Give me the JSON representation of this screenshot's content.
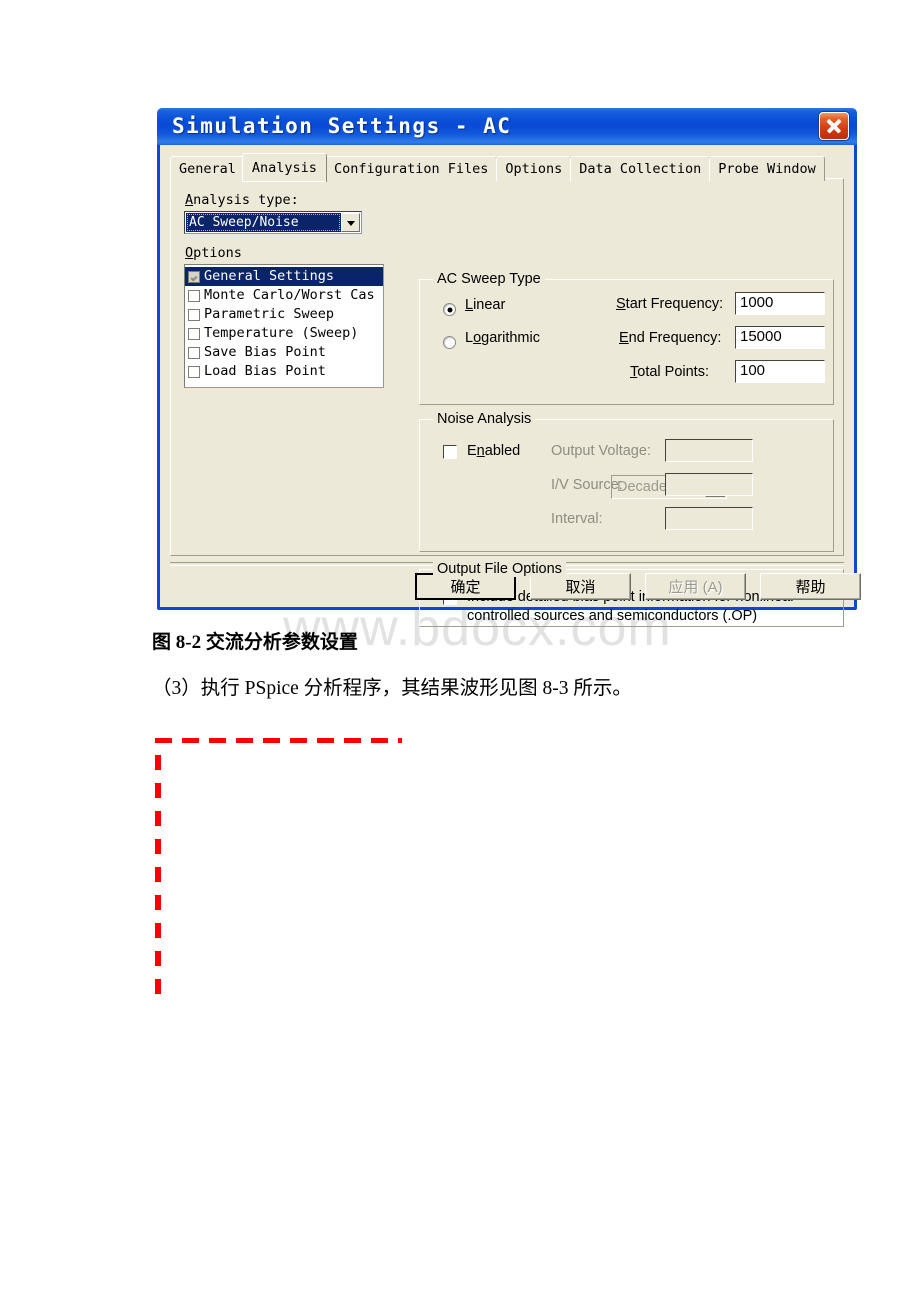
{
  "page": {
    "watermark": "www.bdocx.com",
    "figure_caption": "图 8-2 交流分析参数设置",
    "body_text": "（3）执行 PSpice 分析程序，其结果波形见图 8-3 所示。"
  },
  "dialog": {
    "title": "Simulation Settings - AC",
    "close_icon": "close-icon",
    "tabs": [
      {
        "label": "General",
        "selected": false
      },
      {
        "label": "Analysis",
        "selected": true
      },
      {
        "label": "Configuration Files",
        "selected": false
      },
      {
        "label": "Options",
        "selected": false
      },
      {
        "label": "Data Collection",
        "selected": false
      },
      {
        "label": "Probe Window",
        "selected": false
      }
    ],
    "left_panel": {
      "analysis_type_label": "Analysis type:",
      "analysis_type_value": "AC Sweep/Noise",
      "options_label": "Options",
      "options": [
        {
          "label": "General Settings",
          "checked": true,
          "selected": true
        },
        {
          "label": "Monte Carlo/Worst Cas",
          "checked": false,
          "selected": false
        },
        {
          "label": "Parametric Sweep",
          "checked": false,
          "selected": false
        },
        {
          "label": "Temperature (Sweep)",
          "checked": false,
          "selected": false
        },
        {
          "label": "Save Bias Point",
          "checked": false,
          "selected": false
        },
        {
          "label": "Load Bias Point",
          "checked": false,
          "selected": false
        }
      ]
    },
    "ac_sweep_type": {
      "group_title": "AC Sweep Type",
      "linear_label": "Linear",
      "linear_selected": true,
      "logarithmic_label": "Logarithmic",
      "logarithmic_selected": false,
      "scale_value": "Decade",
      "start_frequency_label": "Start Frequency:",
      "start_frequency_value": "1000",
      "end_frequency_label": "End Frequency:",
      "end_frequency_value": "15000",
      "total_points_label": "Total Points:",
      "total_points_value": "100"
    },
    "noise_analysis": {
      "group_title": "Noise Analysis",
      "enabled_label": "Enabled",
      "enabled_checked": false,
      "output_voltage_label": "Output Voltage:",
      "output_voltage_value": "",
      "iv_source_label": "I/V Source:",
      "iv_source_value": "",
      "interval_label": "Interval:",
      "interval_value": ""
    },
    "output_file_options": {
      "group_title": "Output File Options",
      "include_checked": false,
      "include_line1": "Include detailed bias point information for nonlinear",
      "include_line2": "controlled sources and semiconductors (.OP)"
    },
    "buttons": {
      "ok": "确定",
      "cancel": "取消",
      "apply": "应用 (A)",
      "help": "帮助"
    }
  }
}
